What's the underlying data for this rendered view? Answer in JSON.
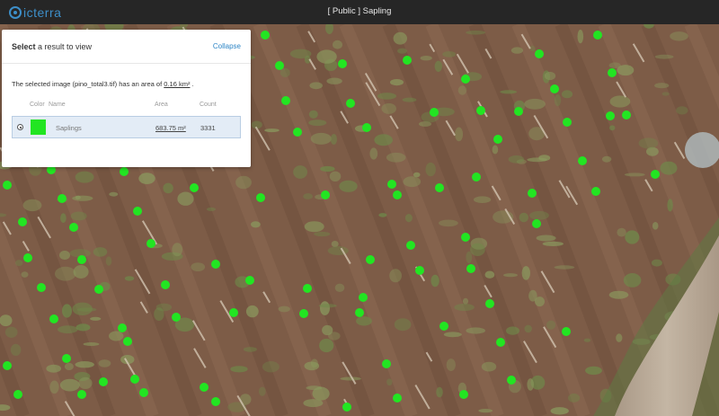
{
  "app": {
    "logo_text": "icterra",
    "window_title": "[ Public ] Sapling"
  },
  "panel": {
    "heading_bold": "Select",
    "heading_rest": " a result to view",
    "collapse_label": "Collapse",
    "info_prefix": "The selected image (pino_total3.tif) has an area of ",
    "info_area": "0.16 km²",
    "info_suffix": " .",
    "columns": {
      "color": "Color",
      "name": "Name",
      "area": "Area",
      "count": "Count"
    },
    "results": [
      {
        "selected": true,
        "color": "#22e522",
        "name": "Saplings",
        "area": "683.75 m²",
        "count": "3331"
      }
    ]
  },
  "colors": {
    "topbar": "#262626",
    "brand": "#3d8fc9",
    "detection": "#22e522",
    "soil": "#7d5c47",
    "road": "#b9ab9a"
  },
  "map": {
    "layer": "aerial-image",
    "detection_marker_color": "#22e522"
  }
}
